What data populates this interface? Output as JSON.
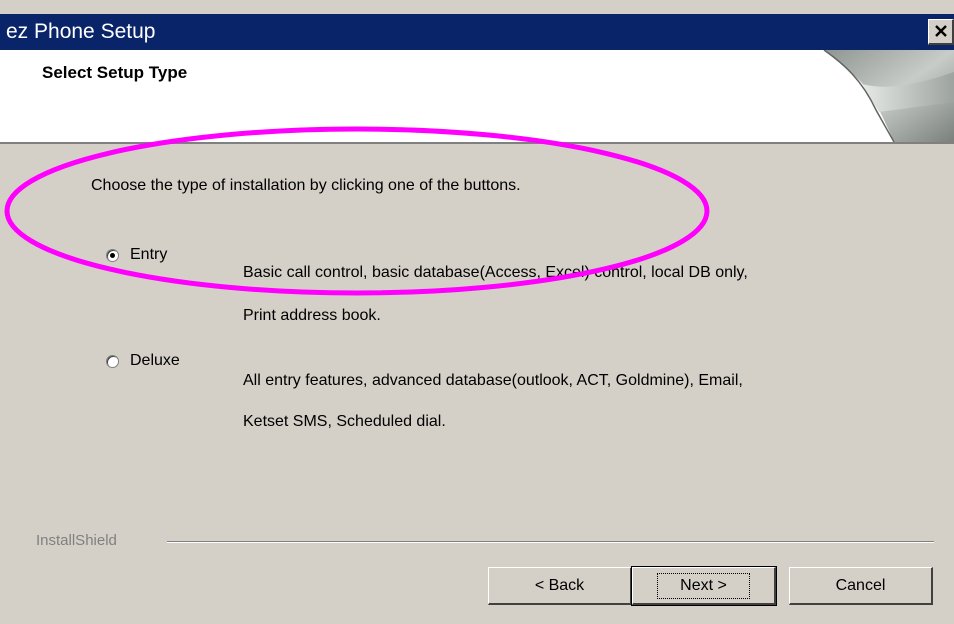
{
  "window": {
    "title": "ez Phone Setup",
    "close_glyph": "×"
  },
  "header": {
    "title": "Select Setup Type"
  },
  "content": {
    "instruction": "Choose the type of installation by clicking one of the buttons.",
    "options": [
      {
        "label": "Entry",
        "selected": true,
        "description_lines": [
          "Basic call control, basic database(Access, Excel) control, local DB only,",
          "Print address book."
        ]
      },
      {
        "label": "Deluxe",
        "selected": false,
        "description_lines": [
          "All entry features, advanced database(outlook, ACT, Goldmine), Email,",
          "Ketset SMS, Scheduled dial."
        ]
      }
    ]
  },
  "footer": {
    "brand": "InstallShield",
    "buttons": {
      "back": "< Back",
      "next": "Next >",
      "cancel": "Cancel"
    }
  },
  "colors": {
    "titlebar": "#0a246a",
    "dialog_bg": "#d4d0c8",
    "annotation": "#ff00ff"
  },
  "icons": {
    "close": "close-x-icon",
    "header_graphic": "curled-page-graphic"
  }
}
